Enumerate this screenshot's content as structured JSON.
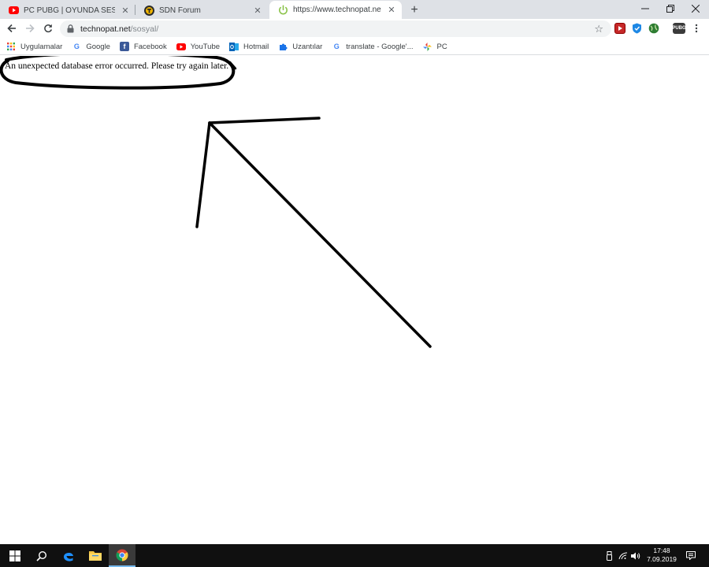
{
  "tabs": [
    {
      "title": "PC PUBG | OYUNDA SESİ AÇIK UR",
      "icon": "youtube-icon",
      "active": false
    },
    {
      "title": "SDN Forum",
      "icon": "sdn-forum-icon",
      "active": false
    },
    {
      "title": "https://www.technopat.net/sosyal",
      "icon": "loading-power-icon",
      "active": true
    }
  ],
  "new_tab_glyph": "+",
  "omnibox": {
    "host": "technopat.net",
    "path": "/sosyal/"
  },
  "bookmarks": [
    {
      "label": "Uygulamalar",
      "icon": "apps-grid-icon"
    },
    {
      "label": "Google",
      "icon": "google-icon"
    },
    {
      "label": "Facebook",
      "icon": "facebook-icon"
    },
    {
      "label": "YouTube",
      "icon": "youtube-icon"
    },
    {
      "label": "Hotmail",
      "icon": "outlook-icon"
    },
    {
      "label": "Uzantılar",
      "icon": "puzzle-icon"
    },
    {
      "label": "translate - Google'...",
      "icon": "google-icon"
    },
    {
      "label": "PC",
      "icon": "pinwheel-icon"
    }
  ],
  "page": {
    "error_message": "An unexpected database error occurred. Please try again later."
  },
  "toolbar_extensions": {
    "pubg_label": "PUBG"
  },
  "clock": {
    "time": "17:48",
    "date": "7.09.2019"
  },
  "colors": {
    "tabstrip": "#dee1e6",
    "omnibox": "#f1f3f4",
    "taskbar": "#101010",
    "annotation_ink": "#000000",
    "loading_spinner": "#8bc34a",
    "youtube_red": "#ff0000",
    "facebook_blue": "#3b5998"
  }
}
